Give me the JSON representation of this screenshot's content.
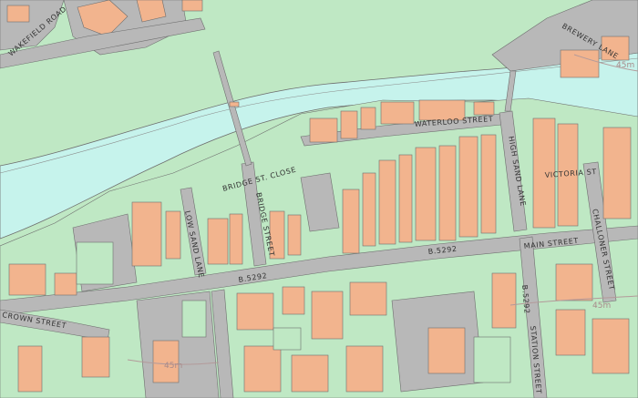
{
  "colors": {
    "land": "#bfe8c4",
    "water": "#c6f3ec",
    "road": "#b8b8b8",
    "building": "#f2b48e",
    "outline": "#6e6e6e",
    "contour": "#b39a9a"
  },
  "labels": {
    "wakefield_road": "WAKEFIELD ROAD",
    "brewery_lane": "BREWERY LANE",
    "waterloo_street": "WATERLOO STREET",
    "high_sand_lane": "HIGH SAND LANE",
    "victoria_street": "VICTORIA ST",
    "bridge_st_close": "BRIDGE ST. CLOSE",
    "bridge_street": "BRIDGE STREET",
    "low_sand_lane": "LOW SAND LANE",
    "main_street": "MAIN STREET",
    "b5292_east": "B.5292",
    "b5292_west": "B.5292",
    "b5292_south": "B.5292",
    "challoner_street": "CHALLONER STREET",
    "crown_street": "CROWN STREET",
    "station_street": "STATION STREET"
  },
  "contours": {
    "c1": "45m",
    "c2": "45m",
    "c3": "45m"
  }
}
